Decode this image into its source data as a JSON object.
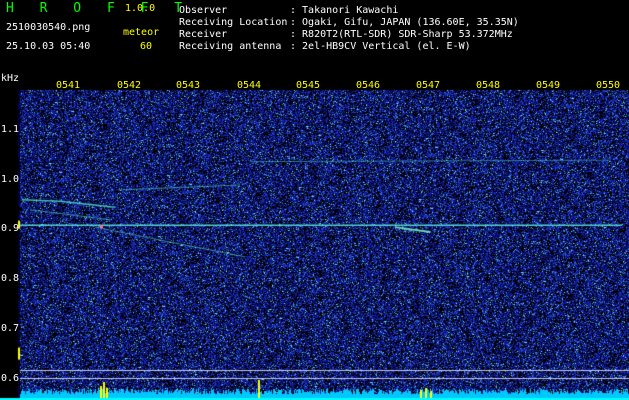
{
  "app": {
    "title": "H R O F F T",
    "version": "1.0.0"
  },
  "file": {
    "name": "2510030540.png",
    "datetime": "25.10.03 05:40"
  },
  "meteor": {
    "label": "meteor",
    "count": "60"
  },
  "info": {
    "observer_label": "Observer",
    "observer_value": ": Takanori Kawachi",
    "location_label": "Receiving Location",
    "location_value": ": Ogaki, Gifu, JAPAN (136.60E, 35.35N)",
    "receiver_label": "Receiver",
    "receiver_value": ": R820T2(RTL-SDR) SDR-Sharp 53.372MHz",
    "antenna_label": "Receiving antenna",
    "antenna_value": ": 2el-HB9CV Vertical (el. E-W)"
  },
  "axis": {
    "unit": "kHz",
    "y_ticks": [
      "1.1",
      "1.0",
      "0.9",
      "0.8",
      "0.7",
      "0.6"
    ],
    "x_ticks": [
      "0541",
      "0542",
      "0543",
      "0544",
      "0545",
      "0546",
      "0547",
      "0548",
      "0549",
      "0550"
    ]
  },
  "colors": {
    "background": "#000000",
    "noise": "#1a2a9a",
    "trace": "#40e0e0",
    "header_green": "#00ff00",
    "header_yellow": "#ffff00"
  }
}
